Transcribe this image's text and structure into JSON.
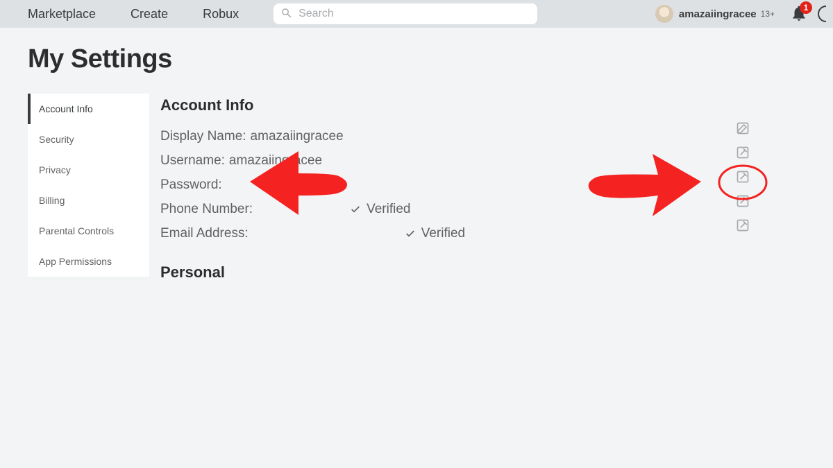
{
  "nav": {
    "items": [
      "Marketplace",
      "Create",
      "Robux"
    ],
    "search_placeholder": "Search"
  },
  "user": {
    "name": "amazaiingracee",
    "display": "amazaiingracee",
    "agebadge": "13+",
    "notif_count": "1"
  },
  "page_title": "My Settings",
  "sidebar": {
    "items": [
      {
        "label": "Account Info",
        "active": true
      },
      {
        "label": "Security",
        "active": false
      },
      {
        "label": "Privacy",
        "active": false
      },
      {
        "label": "Billing",
        "active": false
      },
      {
        "label": "Parental Controls",
        "active": false
      },
      {
        "label": "App Permissions",
        "active": false
      }
    ]
  },
  "sections": {
    "account_info_heading": "Account Info",
    "personal_heading": "Personal",
    "fields": {
      "display_name_label": "Display Name:",
      "display_name_value": "amazaiingracee",
      "username_label": "Username:",
      "username_value": "amazaiingracee",
      "password_label": "Password:",
      "password_value": "",
      "phone_label": "Phone Number:",
      "phone_verified": "Verified",
      "email_label": "Email Address:",
      "email_verified": "Verified"
    }
  }
}
